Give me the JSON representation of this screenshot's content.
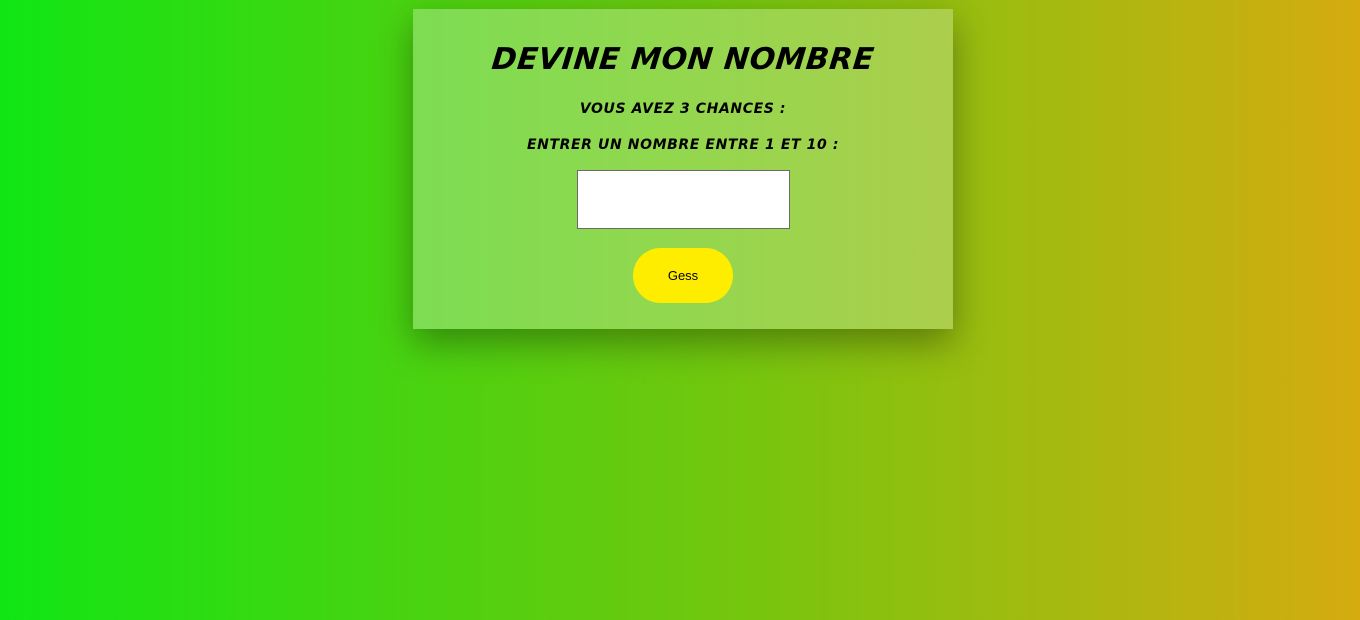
{
  "game": {
    "title": "Devine mon nombre",
    "chances_text": "Vous avez 3 chances :",
    "prompt_text": "Entrer un nombre entre 1 et 10 :",
    "guess_input": {
      "value": "",
      "placeholder": ""
    },
    "guess_button_label": "Gess"
  },
  "colors": {
    "background_left": "#10e614",
    "background_right": "#d5ab10",
    "card": "#93d74e",
    "button": "#ffed00"
  }
}
